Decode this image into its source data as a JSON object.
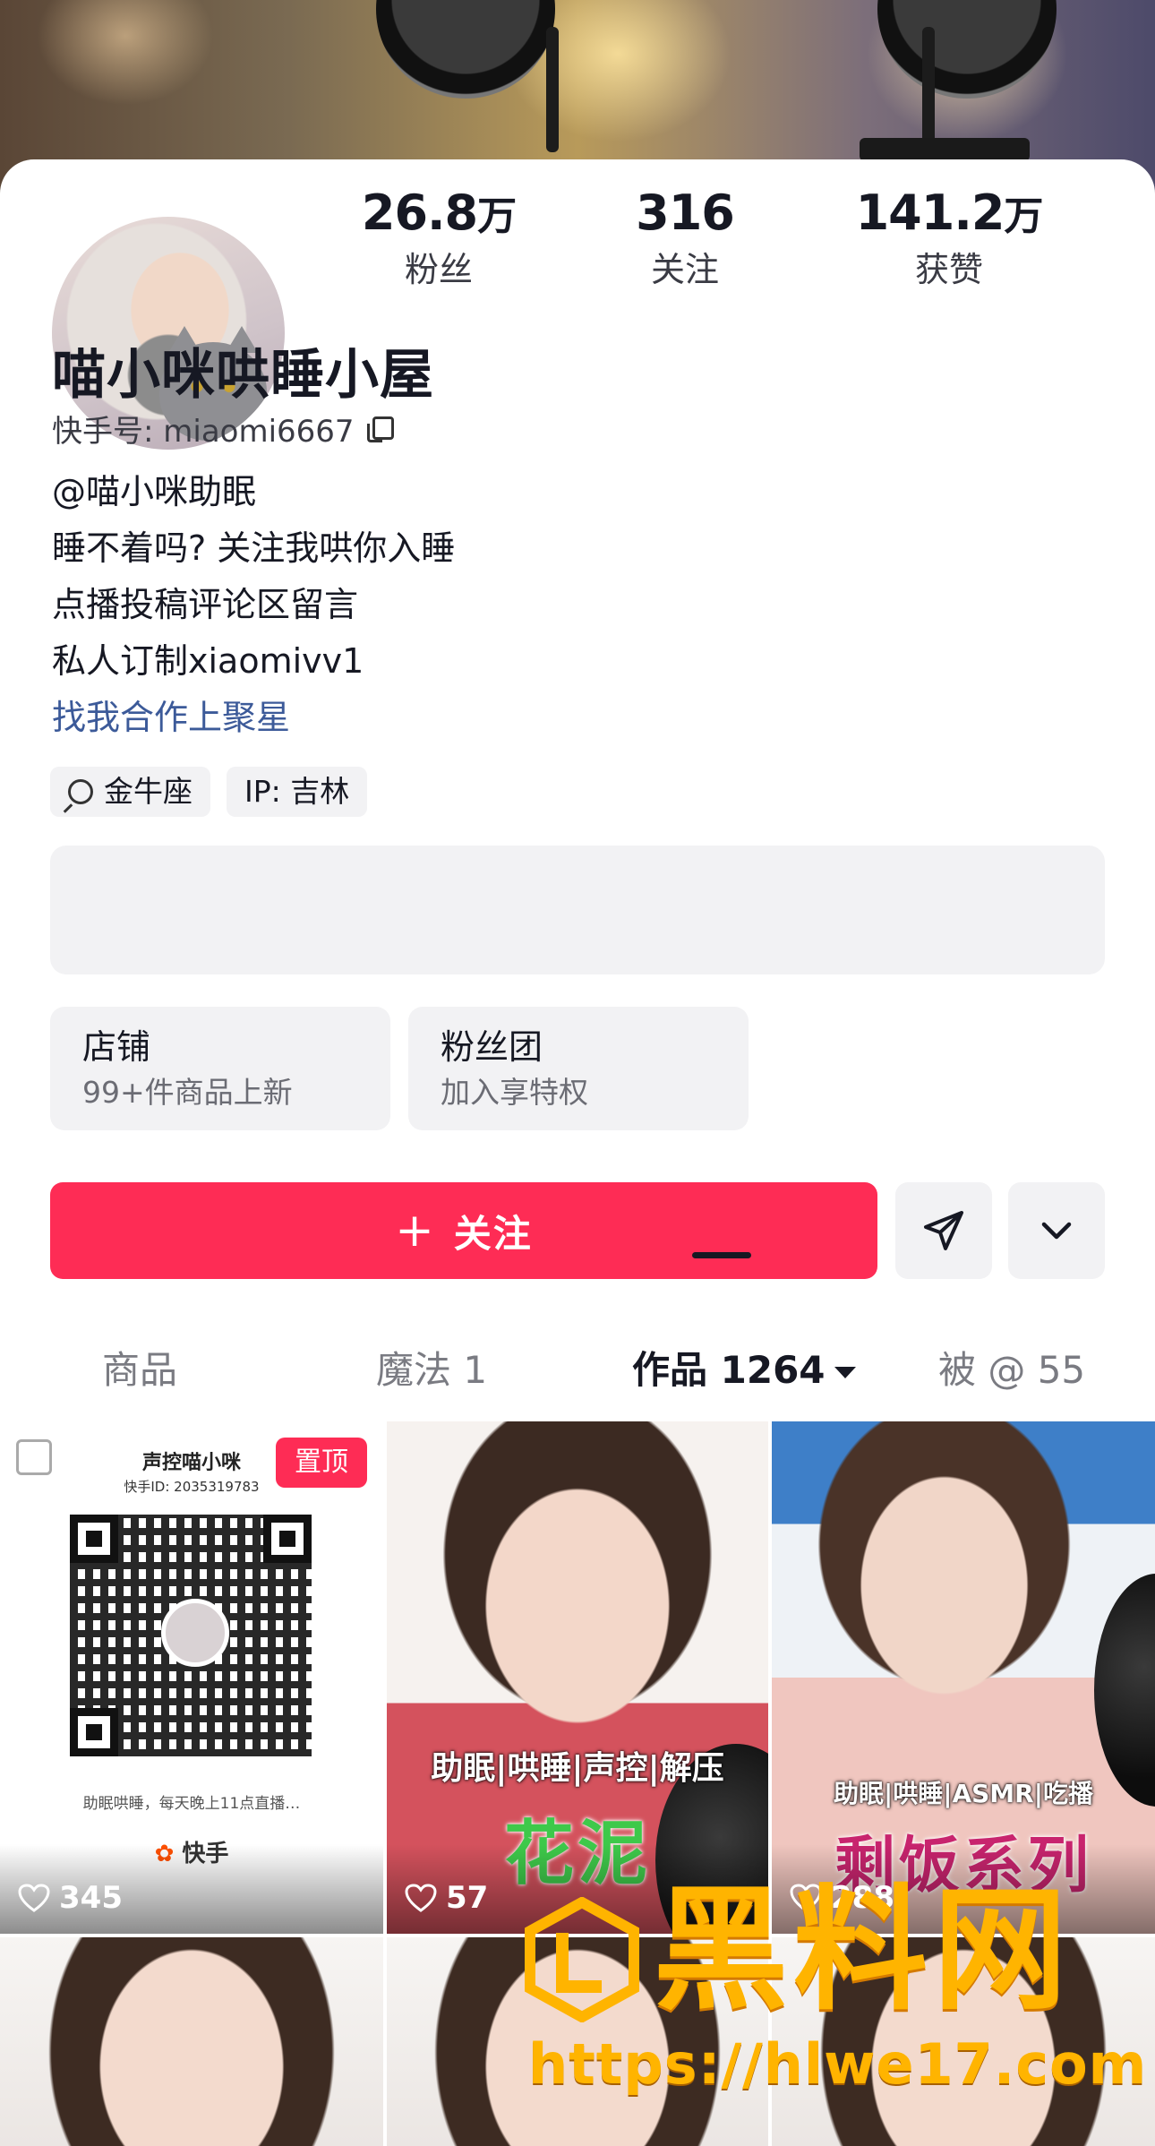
{
  "profile": {
    "name": "喵小咪哄睡小屋",
    "uid_label": "快手号: miaomi6667",
    "stats": [
      {
        "num": "26.8",
        "unit": "万",
        "label": "粉丝"
      },
      {
        "num": "316",
        "unit": "",
        "label": "关注"
      },
      {
        "num": "141.2",
        "unit": "万",
        "label": "获赞"
      }
    ],
    "bio": [
      "@喵小咪助眠",
      "睡不着吗? 关注我哄你入睡",
      "点播投稿评论区留言",
      "私人订制xiaomivv1"
    ],
    "bio_link": "找我合作上聚星",
    "tags": {
      "zodiac": "金牛座",
      "ip": "IP: 吉林"
    }
  },
  "cards": [
    {
      "title": "店铺",
      "subtitle": "99+件商品上新"
    },
    {
      "title": "粉丝团",
      "subtitle": "加入享特权"
    }
  ],
  "actions": {
    "follow_plus": "+",
    "follow": "关注"
  },
  "tabs": {
    "shop": "商品",
    "magic": "魔法 1",
    "works": "作品 1264",
    "mentioned": "被 @ 55"
  },
  "grid": {
    "pinned": {
      "badge": "置顶",
      "title": "声控喵小咪",
      "id": "快手ID: 2035319783",
      "note": "助眠哄睡，每天晚上11点直播…",
      "brand": "快手",
      "likes": "345"
    },
    "video2": {
      "tags": "助眠|哄睡|声控|解压",
      "big": "花泥",
      "likes": "57"
    },
    "video3": {
      "tags": "助眠|哄睡|ASMR|吃播",
      "big": "剩饭系列",
      "likes": "288"
    }
  },
  "watermark": {
    "title": "黑料网",
    "url": "https://hlwe17.com"
  },
  "colors": {
    "accent": "#fe2c55",
    "link": "#3c5a99",
    "watermark": "#ffb400"
  }
}
